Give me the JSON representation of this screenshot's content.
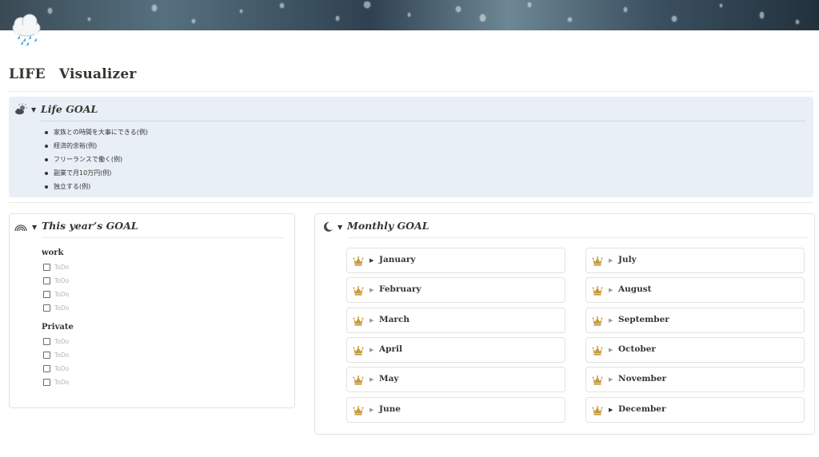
{
  "page": {
    "title": "LIFE　Visualizer",
    "cover": "rain-on-glass-cover",
    "icon": "rain-cloud-icon"
  },
  "life_goal": {
    "icon": "sun-behind-cloud-icon",
    "heading": "Life GOAL",
    "bg_color": "#e8eff7",
    "items": [
      "家族との時間を大事にできる(例)",
      "経済的余裕(例)",
      "フリーランスで働く(例)",
      "副業で月10万円(例)",
      "独立する(例)"
    ]
  },
  "year_goal": {
    "icon": "rainbow-icon",
    "heading": "This year’s GOAL",
    "groups": [
      {
        "label": "work",
        "todos": [
          "ToDo",
          "ToDo",
          "ToDo",
          "ToDo"
        ]
      },
      {
        "label": "Private",
        "todos": [
          "ToDo",
          "ToDo",
          "ToDo",
          "ToDo"
        ]
      }
    ]
  },
  "monthly_goal": {
    "icon": "crescent-moon-icon",
    "heading": "Monthly GOAL",
    "accent_color": "#c49a3c",
    "months_left": [
      "January",
      "February",
      "March",
      "April",
      "May",
      "June"
    ],
    "months_right": [
      "July",
      "August",
      "September",
      "October",
      "November",
      "December"
    ]
  }
}
